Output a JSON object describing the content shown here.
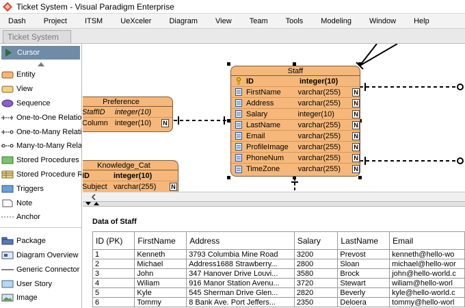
{
  "window": {
    "title": "Ticket System - Visual Paradigm Enterprise"
  },
  "menu": [
    "Dash",
    "Project",
    "ITSM",
    "UeXceler",
    "Diagram",
    "View",
    "Team",
    "Tools",
    "Modeling",
    "Window",
    "Help"
  ],
  "tab": {
    "label": "Ticket System"
  },
  "palette": {
    "cursor_label": "Cursor",
    "items": [
      {
        "label": "Entity",
        "icon": "entity-icon"
      },
      {
        "label": "View",
        "icon": "view-icon"
      },
      {
        "label": "Sequence",
        "icon": "sequence-icon"
      },
      {
        "label": "One-to-One Relation",
        "icon": "one-to-one-icon"
      },
      {
        "label": "One-to-Many Relation",
        "icon": "one-to-many-icon"
      },
      {
        "label": "Many-to-Many Relation",
        "icon": "many-to-many-icon"
      },
      {
        "label": "Stored Procedures",
        "icon": "stored-procedures-icon"
      },
      {
        "label": "Stored Procedure ResultSet",
        "icon": "resultset-icon"
      },
      {
        "label": "Triggers",
        "icon": "triggers-icon"
      },
      {
        "label": "Note",
        "icon": "note-icon"
      },
      {
        "label": "Anchor",
        "icon": "anchor-icon"
      }
    ],
    "items2": [
      {
        "label": "Package",
        "icon": "package-icon"
      },
      {
        "label": "Diagram Overview",
        "icon": "diagram-overview-icon"
      },
      {
        "label": "Generic Connector",
        "icon": "connector-icon"
      },
      {
        "label": "User Story",
        "icon": "user-story-icon"
      },
      {
        "label": "Image",
        "icon": "image-icon"
      }
    ]
  },
  "entities": {
    "staff": {
      "title": "Staff",
      "columns": [
        {
          "name": "ID",
          "type": "integer(10)",
          "pk": true,
          "nullable": false
        },
        {
          "name": "FirstName",
          "type": "varchar(255)",
          "nullable": true
        },
        {
          "name": "Address",
          "type": "varchar(255)",
          "nullable": true
        },
        {
          "name": "Salary",
          "type": "integer(10)",
          "nullable": true
        },
        {
          "name": "LastName",
          "type": "varchar(255)",
          "nullable": true
        },
        {
          "name": "Email",
          "type": "varchar(255)",
          "nullable": true
        },
        {
          "name": "ProfileImage",
          "type": "varchar(255)",
          "nullable": true
        },
        {
          "name": "PhoneNum",
          "type": "varchar(255)",
          "nullable": true
        },
        {
          "name": "TimeZone",
          "type": "varchar(255)",
          "nullable": true
        }
      ]
    },
    "preference": {
      "title": "Preference",
      "rows": [
        {
          "name": "StaffID",
          "type": "integer(10)"
        },
        {
          "name": "Column",
          "type": "integer(10)",
          "n": "N"
        }
      ]
    },
    "knowledge_cat": {
      "title": "Knowledge_Cat",
      "rows": [
        {
          "name": "ID",
          "type": "integer(10)"
        },
        {
          "name": "Subject",
          "type": "varchar(255)",
          "n": "N"
        }
      ]
    }
  },
  "data_pane": {
    "title": "Data of Staff",
    "headers": [
      "ID (PK)",
      "FirstName",
      "Address",
      "Salary",
      "LastName",
      "Email"
    ],
    "rows": [
      [
        "1",
        "Kenneth",
        "3793 Columbia Mine Road",
        "3200",
        "Prevost",
        "kenneth@hello-wo"
      ],
      [
        "2",
        "Michael",
        "Address1688 Strawberry...",
        "2800",
        "Sloan",
        "michael@hello-wor"
      ],
      [
        "3",
        "John",
        "347 Hanover Drive  Louvi...",
        "3580",
        "Brock",
        "john@hello-world.c"
      ],
      [
        "4",
        "Wiliam",
        "916 Manor Station Avenu...",
        "3720",
        "Stewart",
        "wiliam@hello-worl"
      ],
      [
        "5",
        "Kyle",
        "545 Sherman Drive  Glen...",
        "2820",
        "Beverly",
        "kyle@hello-world.c"
      ],
      [
        "6",
        "Tommy",
        "8 Bank Ave.  Port Jeffers...",
        "2350",
        "Deloera",
        "tommy@hello-worl"
      ]
    ]
  },
  "colors": {
    "entity_fill": "#f5b87a",
    "palette_selected": "#6f8ba8"
  }
}
